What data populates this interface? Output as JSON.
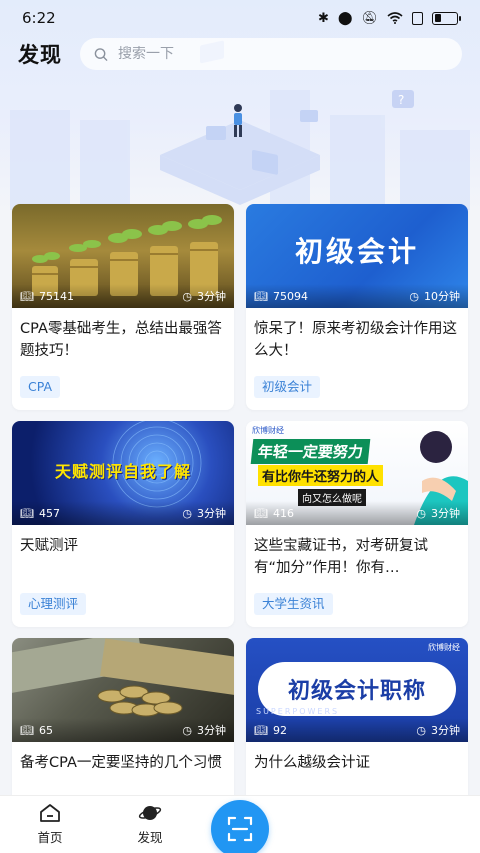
{
  "status_bar": {
    "time": "6:22"
  },
  "header": {
    "title": "发现",
    "search_placeholder": "搜索一下"
  },
  "cards": [
    {
      "views": "75141",
      "duration": "3分钟",
      "title": "CPA零基础考生，总结出最强答题技巧！",
      "tag": "CPA",
      "banner": ""
    },
    {
      "views": "75094",
      "duration": "10分钟",
      "title": "惊呆了！原来考初级会计作用这么大！",
      "tag": "初级会计",
      "banner": "初级会计"
    },
    {
      "views": "457",
      "duration": "3分钟",
      "title": "天赋测评",
      "tag": "心理测评",
      "banner": "天赋测评自我了解"
    },
    {
      "views": "416",
      "duration": "3分钟",
      "title": "这些宝藏证书，对考研复试有“加分”作用！你有…",
      "tag": "大学生资讯",
      "banner_line1": "年轻一定要努力",
      "banner_line2": "有比你牛还努力的人",
      "banner_line3": "向又怎么做呢",
      "brand": "欣博财经"
    },
    {
      "views": "65",
      "duration": "3分钟",
      "title": "备考CPA一定要坚持的几个习惯",
      "tag": "",
      "banner": ""
    },
    {
      "views": "92",
      "duration": "3分钟",
      "title": "为什么越级会计证",
      "tag": "",
      "banner": "初级会计职称",
      "brand": "欣博财经",
      "watermark": "SUPERPOWERS"
    }
  ],
  "bottom_nav": {
    "home_label": "首页",
    "discover_label": "发现"
  },
  "colors": {
    "accent": "#2196f3",
    "tag_bg": "#eaf3ff",
    "tag_text": "#3b82d6"
  }
}
